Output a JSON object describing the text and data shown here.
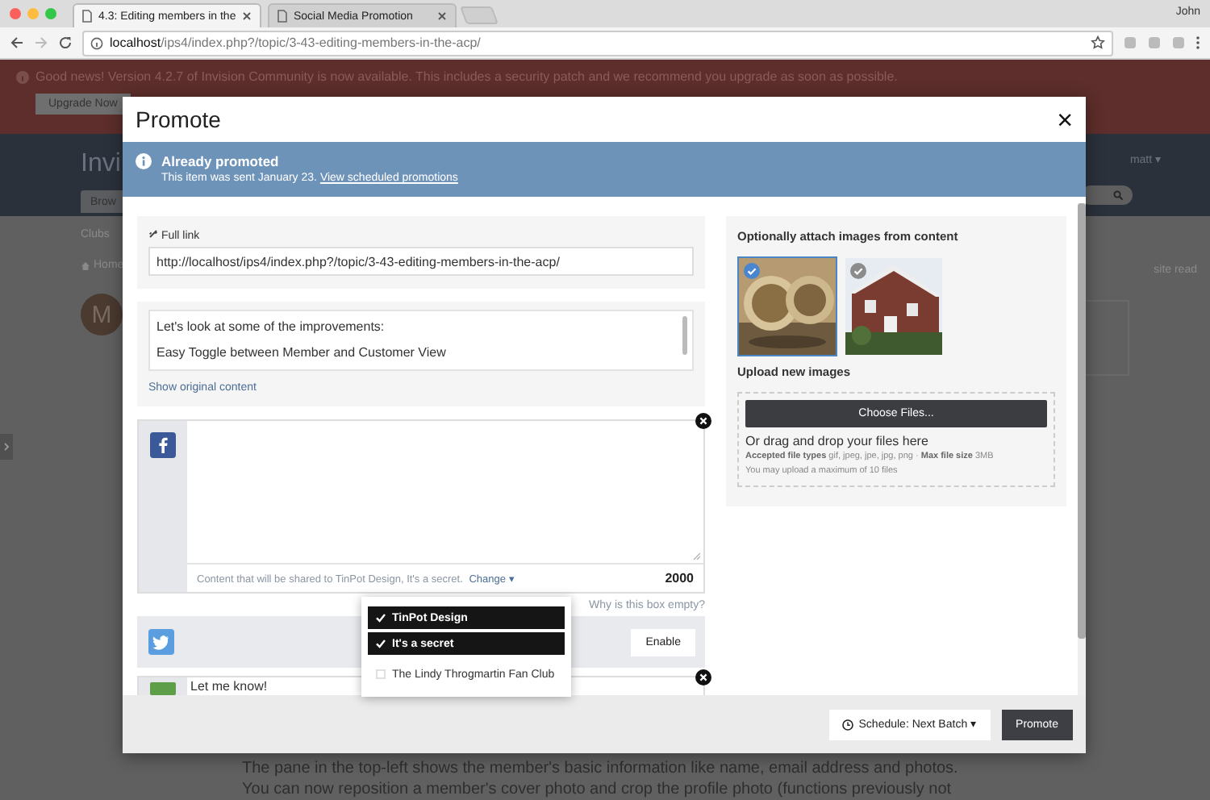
{
  "browser": {
    "tabs": [
      {
        "title": "4.3: Editing members in the",
        "selected": true
      },
      {
        "title": "Social Media Promotion",
        "selected": false
      }
    ],
    "profile": "John",
    "address": {
      "host": "localhost",
      "path": "/ips4/index.php?/topic/3-43-editing-members-in-the-acp/"
    }
  },
  "background": {
    "notice": "Good news! Version 4.2.7 of Invision Community is now available. This includes a security patch and we recommend you upgrade as soon as possible.",
    "upgrade_button": "Upgrade Now",
    "site_title": "Invi",
    "user_menu": "matt ▾",
    "nav_tab": "Brow",
    "subnav": "Clubs",
    "breadcrumb": "Home",
    "mark_read": "site read",
    "avatar_letter": "M",
    "article_lines": [
      "The pane in the top-left shows the member's basic information like name, email address and photos.",
      "You can now reposition a member's cover photo and crop the profile photo (functions previously not"
    ]
  },
  "modal": {
    "title": "Promote",
    "close": "×",
    "notice": {
      "title": "Already promoted",
      "text": "This item was sent January 23.",
      "link": "View scheduled promotions"
    },
    "full_link": {
      "label": "Full link",
      "value": "http://localhost/ips4/index.php?/topic/3-43-editing-members-in-the-acp/"
    },
    "content": {
      "lines": [
        "Let's look at some of the improvements:",
        "Easy Toggle between Member and Customer View"
      ],
      "show_original": "Show original content"
    },
    "services": [
      {
        "kind": "facebook",
        "enabled": true,
        "share_note": "Content that will be shared to TinPot Design, It's a secret.",
        "change": "Change ▾",
        "count": "2000",
        "help": "Why is this box empty?"
      },
      {
        "kind": "twitter",
        "enabled": false,
        "button": "Enable"
      },
      {
        "kind": "message",
        "enabled": true,
        "text": "Let me know!"
      }
    ],
    "audience_menu": [
      {
        "label": "TinPot Design",
        "checked": true
      },
      {
        "label": "It's a secret",
        "checked": true
      },
      {
        "label": "The Lindy Throgmartin Fan Club",
        "checked": false
      }
    ],
    "images": {
      "title": "Optionally attach images from content",
      "items": [
        {
          "kind": "coins",
          "selected": true
        },
        {
          "kind": "house",
          "selected": false
        }
      ]
    },
    "upload": {
      "title": "Upload new images",
      "button": "Choose Files...",
      "drop_text": "Or drag and drop your files here",
      "accepted": "**Accepted file types** gif, jpeg, jpe, jpg, png · **Max file size** 3MB",
      "limit": "You may upload a maximum of 10 files"
    },
    "footer": {
      "schedule": "Schedule: Next Batch ▾",
      "submit": "Promote"
    }
  }
}
